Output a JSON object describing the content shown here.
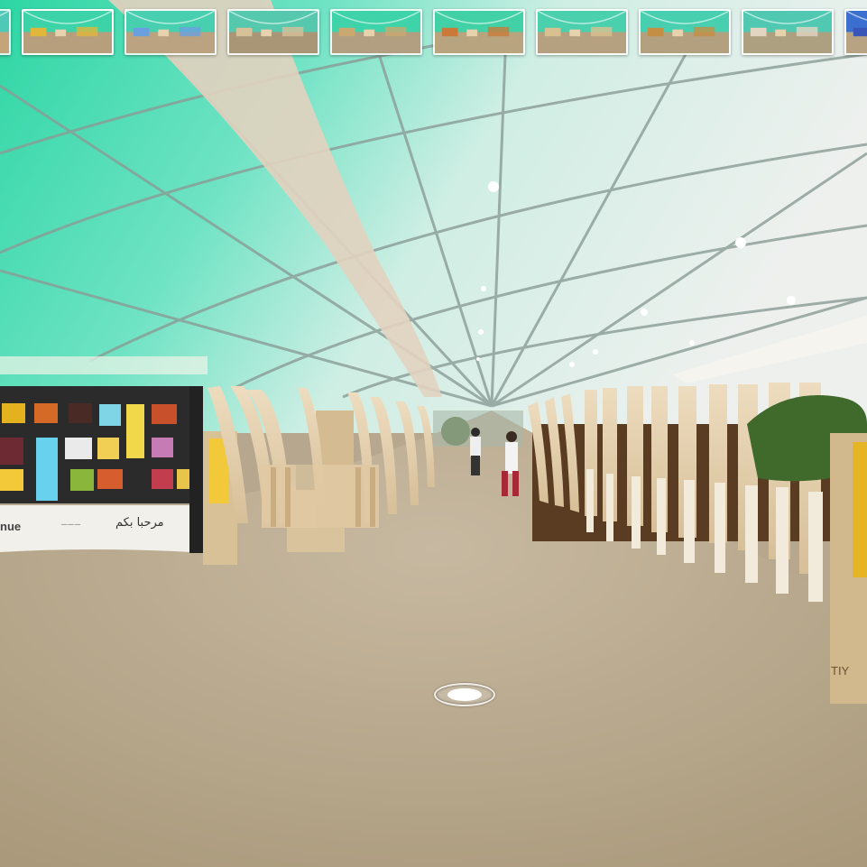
{
  "viewer": {
    "thumbnails": [
      {
        "name": "scene-1"
      },
      {
        "name": "scene-2"
      },
      {
        "name": "scene-3"
      },
      {
        "name": "scene-4"
      },
      {
        "name": "scene-5"
      },
      {
        "name": "scene-6"
      },
      {
        "name": "scene-7"
      },
      {
        "name": "scene-8"
      },
      {
        "name": "scene-9"
      },
      {
        "name": "scene-10"
      }
    ],
    "booth": {
      "left_text": "nue",
      "logo_text": "───",
      "arabic_text": "مرحبا بكم"
    },
    "right_sign_text": "TIY",
    "colors": {
      "ceiling_green": "#3fd8b0",
      "ceiling_light": "#e9eeea",
      "floor": "#b5a68d",
      "wood": "#e4cfae"
    }
  }
}
